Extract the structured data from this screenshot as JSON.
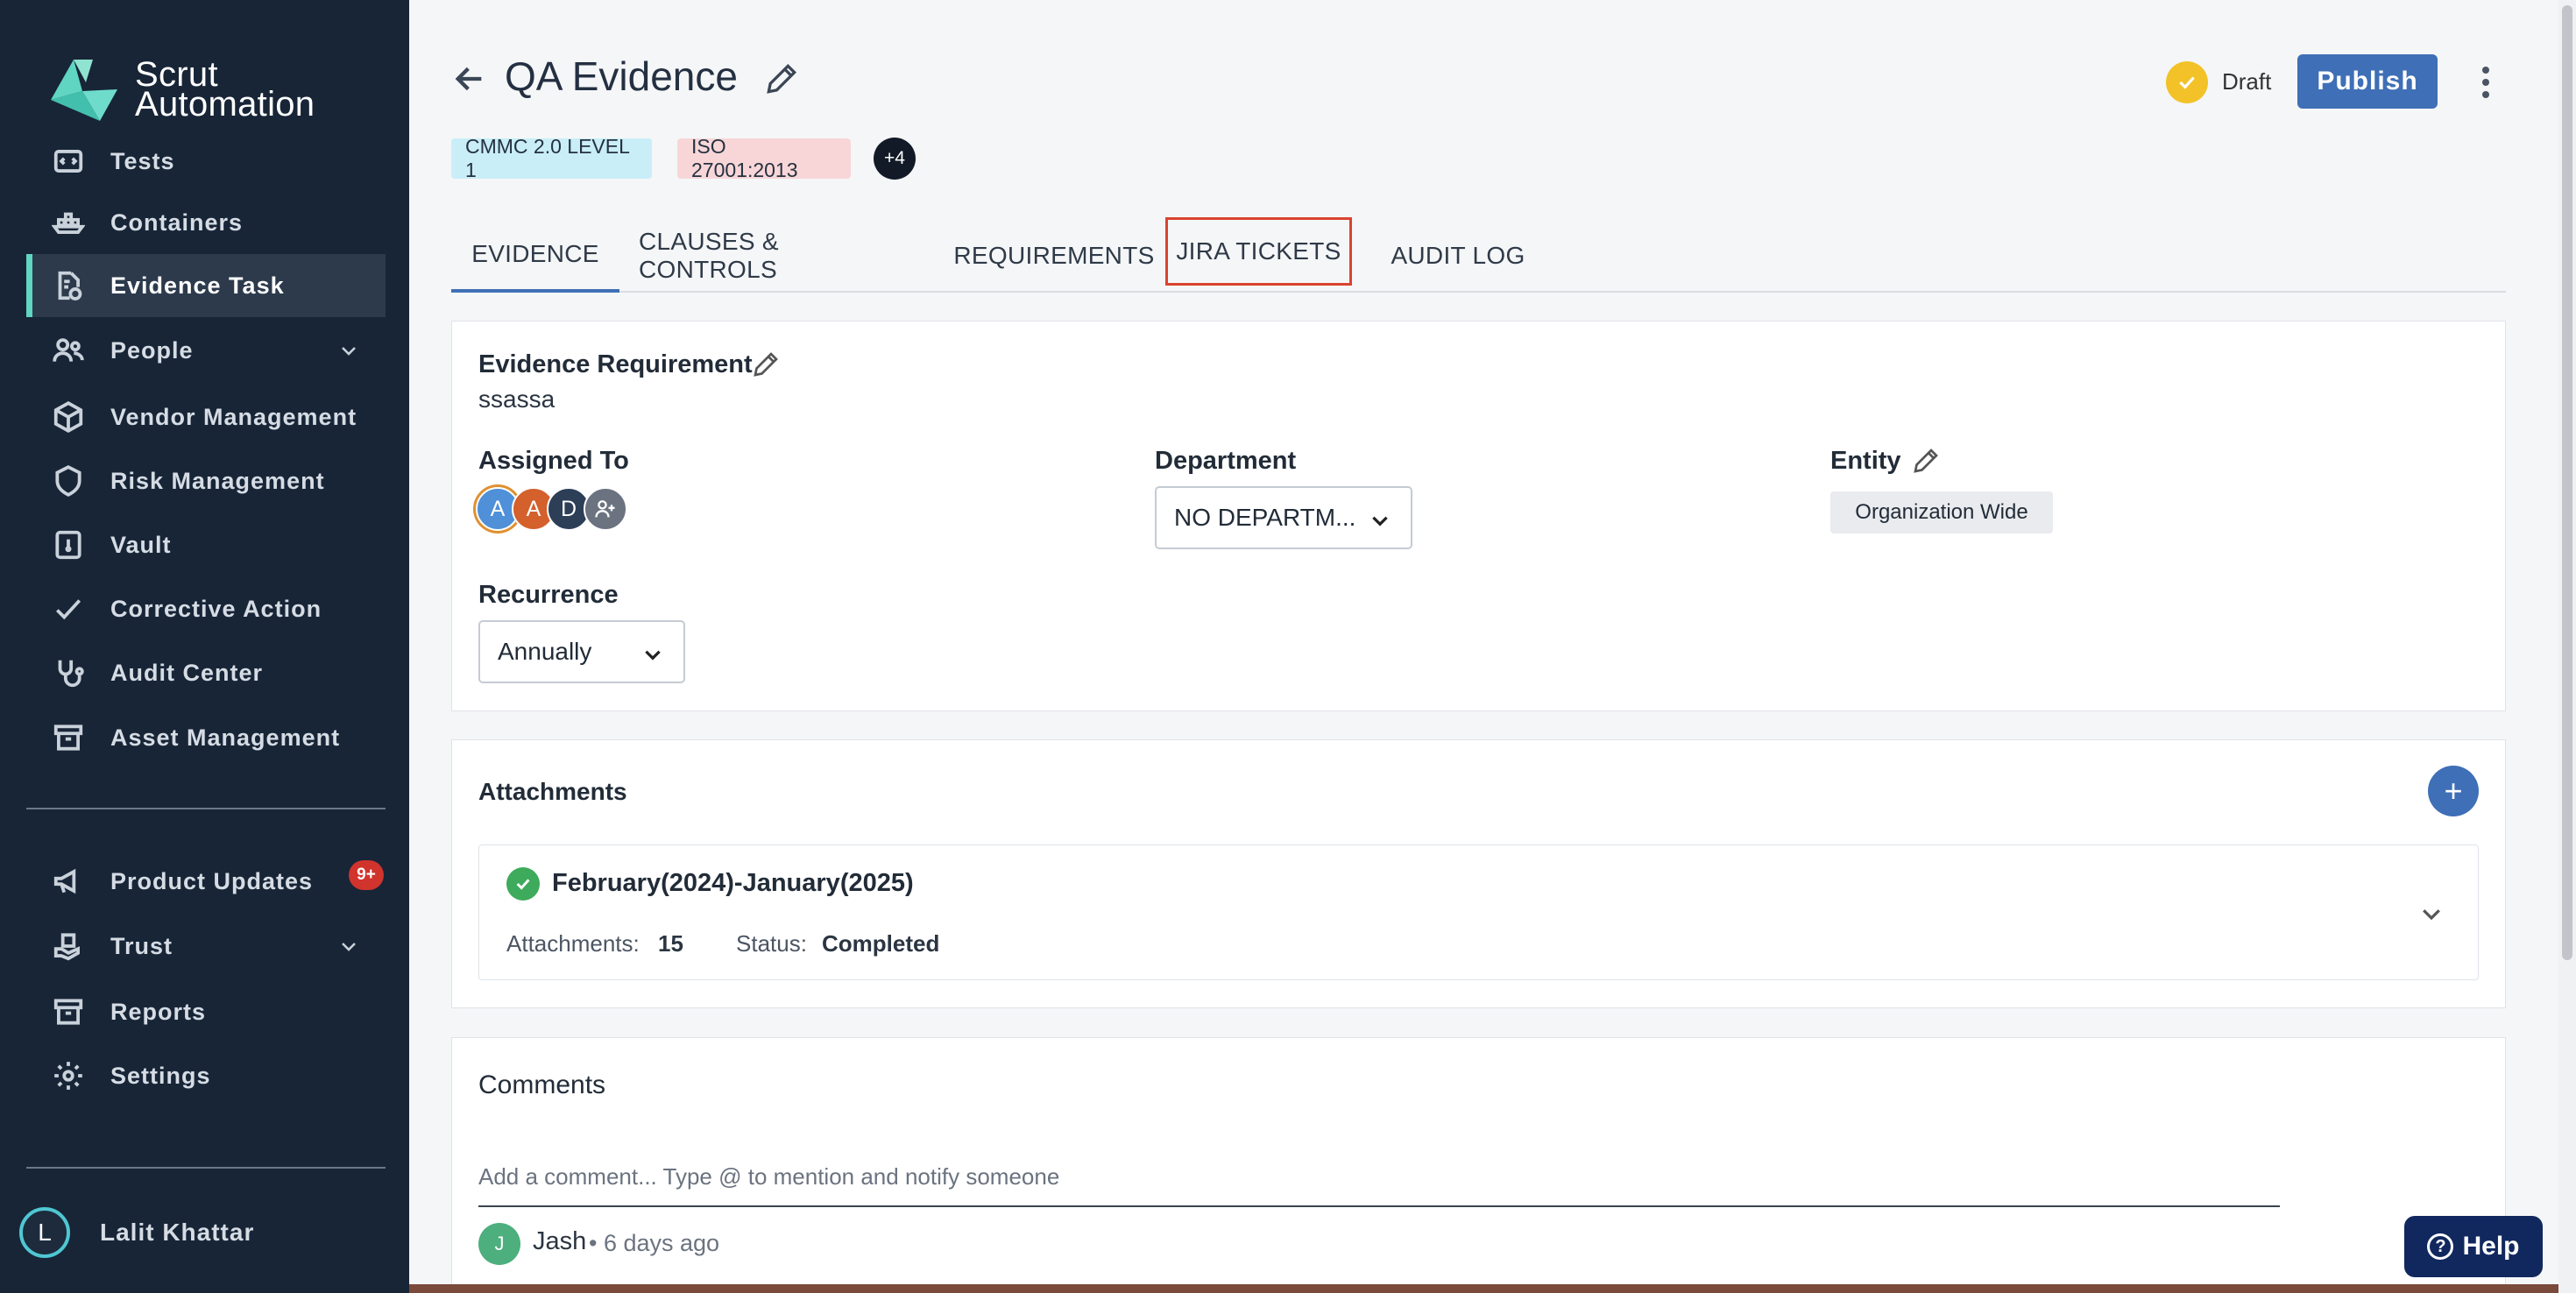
{
  "sidebar": {
    "brand_line1": "Scrut",
    "brand_line2": "Automation",
    "items": [
      {
        "label": "Tests"
      },
      {
        "label": "Containers"
      },
      {
        "label": "Evidence Task"
      },
      {
        "label": "People"
      },
      {
        "label": "Vendor Management"
      },
      {
        "label": "Risk Management"
      },
      {
        "label": "Vault"
      },
      {
        "label": "Corrective Action"
      },
      {
        "label": "Audit Center"
      },
      {
        "label": "Asset Management"
      },
      {
        "label": "Product Updates"
      },
      {
        "label": "Trust"
      },
      {
        "label": "Reports"
      },
      {
        "label": "Settings"
      }
    ],
    "updates_badge": "9+",
    "user": {
      "initial": "L",
      "name": "Lalit Khattar"
    }
  },
  "header": {
    "title": "QA Evidence",
    "status": "Draft",
    "publish_label": "Publish",
    "tags": [
      "CMMC 2.0 LEVEL 1",
      "ISO 27001:2013"
    ],
    "more_tags": "+4"
  },
  "tabs": [
    "EVIDENCE",
    "CLAUSES & CONTROLS",
    "REQUIREMENTS",
    "JIRA TICKETS",
    "AUDIT LOG"
  ],
  "details": {
    "evidence_requirement_label": "Evidence Requirement",
    "evidence_requirement_value": "ssassa",
    "assigned_to_label": "Assigned To",
    "assignees": [
      "A",
      "A",
      "D"
    ],
    "department_label": "Department",
    "department_value": "NO DEPARTM...",
    "entity_label": "Entity",
    "entity_value": "Organization Wide",
    "recurrence_label": "Recurrence",
    "recurrence_value": "Annually"
  },
  "attachments": {
    "title": "Attachments",
    "add_label": "+",
    "item": {
      "period": "February(2024)-January(2025)",
      "count_label": "Attachments:",
      "count_value": "15",
      "status_label": "Status:",
      "status_value": "Completed"
    }
  },
  "comments": {
    "title": "Comments",
    "placeholder": "Add a comment... Type @ to mention and notify someone",
    "entries": [
      {
        "initial": "J",
        "author": "Jash",
        "time": "• 6 days ago"
      }
    ]
  },
  "help_label": "Help",
  "colors": {
    "sidebar_bg": "#172537",
    "accent": "#3f6fb6",
    "active_marker": "#5fd5c2",
    "highlight_border": "#d9432f",
    "draft_status": "#f2c228",
    "completed_check": "#3daa5c"
  }
}
